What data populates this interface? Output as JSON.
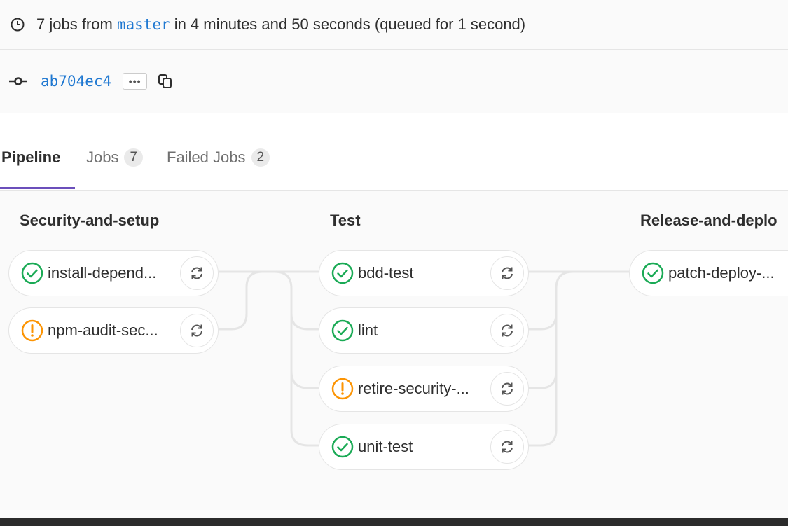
{
  "summary": {
    "prefix": "7 jobs from",
    "branch": "master",
    "suffix": "in 4 minutes and 50 seconds (queued for 1 second)"
  },
  "commit": {
    "sha": "ab704ec4",
    "ellipsis": "•••"
  },
  "tabs": [
    {
      "label": "Pipeline",
      "count": null,
      "active": true
    },
    {
      "label": "Jobs",
      "count": "7",
      "active": false
    },
    {
      "label": "Failed Jobs",
      "count": "2",
      "active": false
    }
  ],
  "stages": [
    {
      "title": "Security-and-setup",
      "jobs": [
        {
          "name": "install-depend...",
          "status": "success"
        },
        {
          "name": "npm-audit-sec...",
          "status": "warning"
        }
      ]
    },
    {
      "title": "Test",
      "jobs": [
        {
          "name": "bdd-test",
          "status": "success"
        },
        {
          "name": "lint",
          "status": "success"
        },
        {
          "name": "retire-security-...",
          "status": "warning"
        },
        {
          "name": "unit-test",
          "status": "success"
        }
      ]
    },
    {
      "title": "Release-and-deplo",
      "jobs": [
        {
          "name": "patch-deploy-...",
          "status": "success"
        }
      ]
    }
  ],
  "colors": {
    "success": "#1aaa55",
    "warning": "#fc9403",
    "link": "#1f78d1",
    "active_tab": "#6b4fbb"
  },
  "icons": {
    "clock": "clock-icon",
    "commit": "commit-icon",
    "copy": "copy-icon",
    "retry": "retry-icon",
    "success": "status-success-icon",
    "warning": "status-warning-icon"
  }
}
